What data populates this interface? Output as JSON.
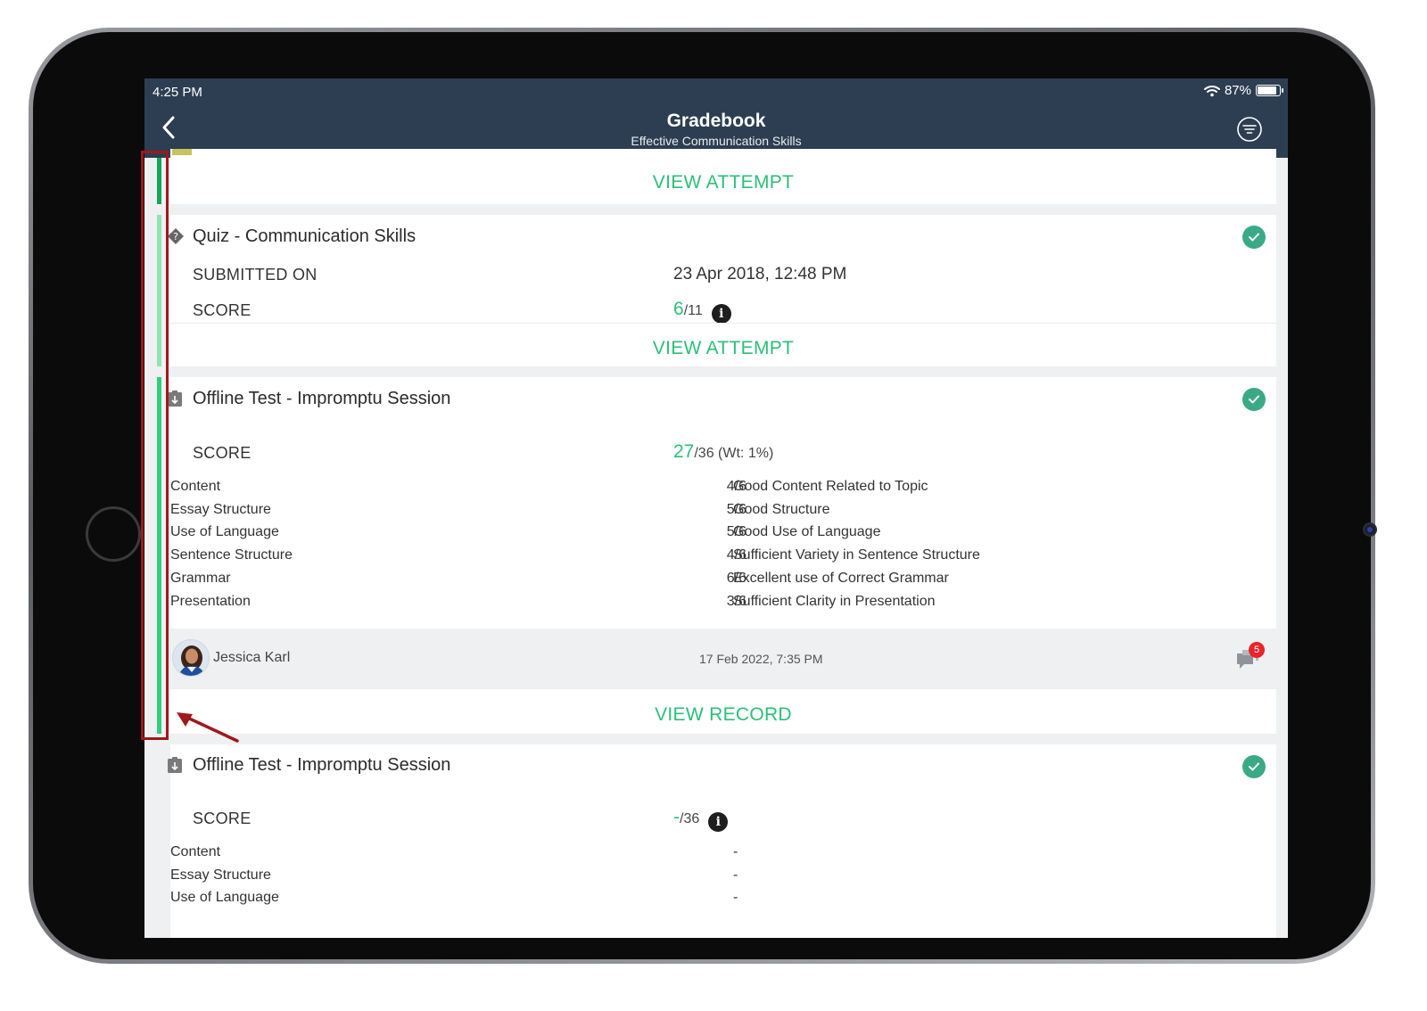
{
  "status_bar": {
    "time": "4:25 PM",
    "battery": "87%",
    "battery_level": 0.87
  },
  "nav": {
    "title": "Gradebook",
    "subtitle": "Effective Communication Skills"
  },
  "top_card": {
    "action": "VIEW ATTEMPT"
  },
  "quiz_card": {
    "title": "Quiz - Communication Skills",
    "submitted_label": "SUBMITTED ON",
    "submitted_value": "23 Apr 2018, 12:48 PM",
    "score_label": "SCORE",
    "score": "6",
    "score_total": "/11",
    "info": "i",
    "action": "VIEW ATTEMPT"
  },
  "offline_card_1": {
    "title": "Offline Test - Impromptu Session",
    "score_label": "SCORE",
    "score": "27",
    "score_total": "/36 (Wt: 1%)",
    "rubric": [
      {
        "name": "Content",
        "score": "4/6",
        "comment": "Good Content Related to Topic"
      },
      {
        "name": "Essay Structure",
        "score": "5/6",
        "comment": "Good Structure"
      },
      {
        "name": "Use of Language",
        "score": "5/6",
        "comment": "Good Use of Language"
      },
      {
        "name": "Sentence Structure",
        "score": "4/6",
        "comment": "Sufficient Variety in Sentence Structure"
      },
      {
        "name": "Grammar",
        "score": "6/6",
        "comment": "Excellent use of Correct Grammar"
      },
      {
        "name": "Presentation",
        "score": "3/6",
        "comment": "Sufficient Clarity in Presentation"
      }
    ],
    "grader": {
      "name": "Jessica Karl",
      "date": "17 Feb 2022, 7:35 PM",
      "comment_count": "5"
    },
    "action": "VIEW RECORD"
  },
  "offline_card_2": {
    "title": "Offline Test - Impromptu Session",
    "score_label": "SCORE",
    "score": "-",
    "score_total": "/36",
    "info": "i",
    "rubric": [
      {
        "name": "Content",
        "value": "-"
      },
      {
        "name": "Essay Structure",
        "value": "-"
      },
      {
        "name": "Use of Language",
        "value": "-"
      }
    ]
  },
  "colors": {
    "header": "#2d3e52",
    "accent_green": "#2cbf79",
    "status_bar_dark": "#12a656",
    "status_bar_light": "#8ee5b4",
    "status_bar_mid": "#2ed07c",
    "check": "#3aaa86",
    "annotation": "#a0181c",
    "badge": "#e5262c"
  },
  "icons": {
    "back": "chevron-left-icon",
    "filter": "filter-icon",
    "wifi": "wifi-icon",
    "battery": "battery-icon",
    "quiz": "quiz-diamond-icon",
    "offline": "offline-test-icon",
    "check": "check-circle-icon",
    "info": "info-icon",
    "comment": "comment-icon"
  }
}
